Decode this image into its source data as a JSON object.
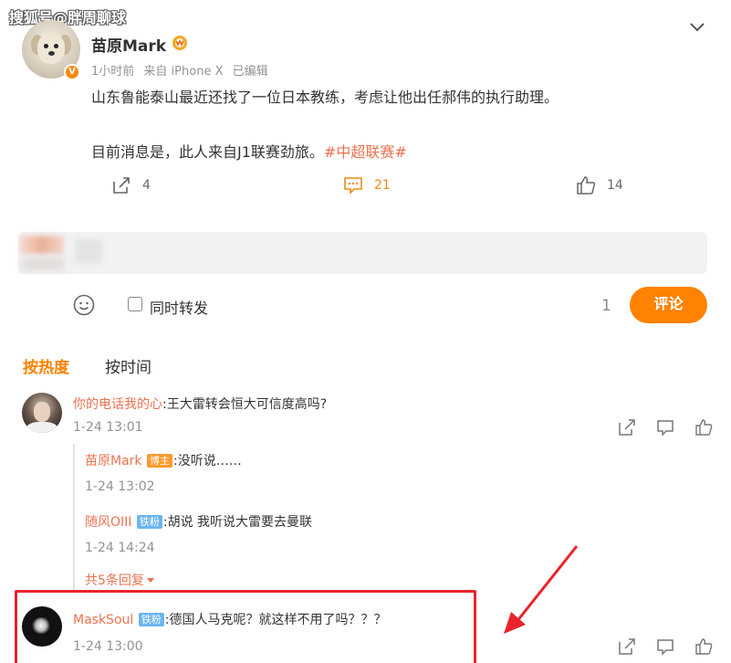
{
  "watermark": "搜狐号@胖周聊球",
  "post": {
    "author": "苗原Mark",
    "verified_mark": "V",
    "meta_time": "1小时前",
    "meta_source": "来自 iPhone X",
    "meta_edited": "已编辑",
    "text_line1": "山东鲁能泰山最近还找了一位日本教练，考虑让他出任郝伟的执行助理。",
    "text_line2": "目前消息是，此人来自J1联赛劲旅。",
    "hashtag": "#中超联赛#",
    "repost_count": "4",
    "comment_count": "21",
    "like_count": "14"
  },
  "composer": {
    "repost_label": "同时转发",
    "counter": "1",
    "submit_label": "评论"
  },
  "sort": {
    "hot_label": "按热度",
    "time_label": "按时间"
  },
  "comments": [
    {
      "name": "你的电话我的心",
      "text": ":王大雷转会恒大可信度高吗?",
      "time": "1-24 13:01"
    },
    {
      "name": "MaskSoul",
      "badge": "铁粉",
      "text": ":德国人马克呢？就这样不用了吗？？？",
      "time": "1-24 13:00"
    }
  ],
  "replies": [
    {
      "name": "苗原Mark",
      "badge": "博主",
      "text": ":没听说……",
      "time": "1-24 13:02"
    },
    {
      "name": "随风OIII",
      "badge": "铁粉",
      "text": ":胡说 我听说大雷要去曼联",
      "time": "1-24 14:24"
    }
  ],
  "more_replies": "共5条回复",
  "colors": {
    "accent": "#ff8200",
    "link": "#eb7350",
    "highlight": "#e8242b"
  },
  "icons": [
    "chevron-down-icon",
    "repost-icon",
    "comment-icon",
    "like-icon",
    "emoji-icon",
    "share-icon",
    "reply-icon",
    "thumb-icon"
  ]
}
